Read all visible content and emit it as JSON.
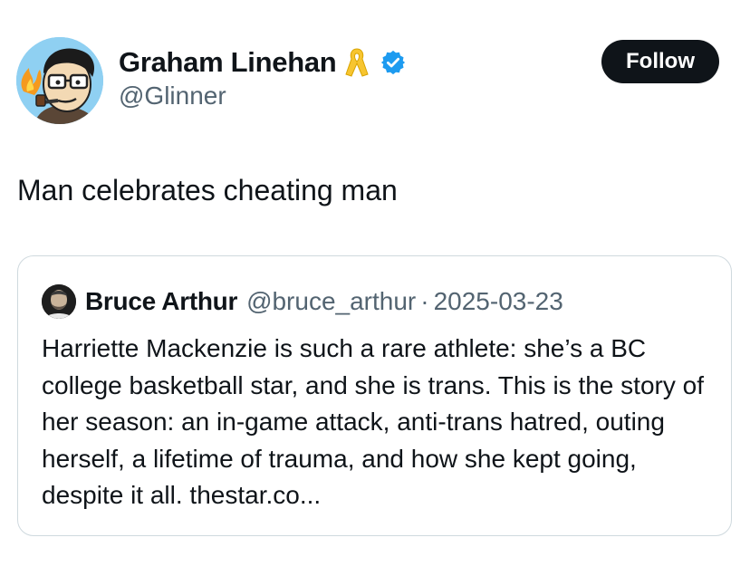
{
  "tweet": {
    "author": {
      "display_name": "Graham Linehan",
      "handle": "@Glinner",
      "avatar_icon": "cartoon-portrait-avatar",
      "badges": [
        "yellow-ribbon-icon",
        "verified-badge-icon"
      ]
    },
    "follow_label": "Follow",
    "text": "Man celebrates cheating man",
    "colors": {
      "follow_bg": "#0f1419",
      "verified": "#1d9bf0",
      "ribbon": "#f7c530",
      "secondary_text": "#536471",
      "card_border": "#cfd9de"
    }
  },
  "quote": {
    "author": {
      "display_name": "Bruce Arthur",
      "handle": "@bruce_arthur",
      "avatar_icon": "photo-avatar"
    },
    "separator": "·",
    "date": "2025-03-23",
    "text": "Harriette Mackenzie is such a rare athlete: she’s a BC college basketball star, and she is trans. This is the story of her season: an in-game attack, anti-trans hatred, outing herself, a lifetime of trauma, and how she kept going, despite it all. thestar.co..."
  }
}
